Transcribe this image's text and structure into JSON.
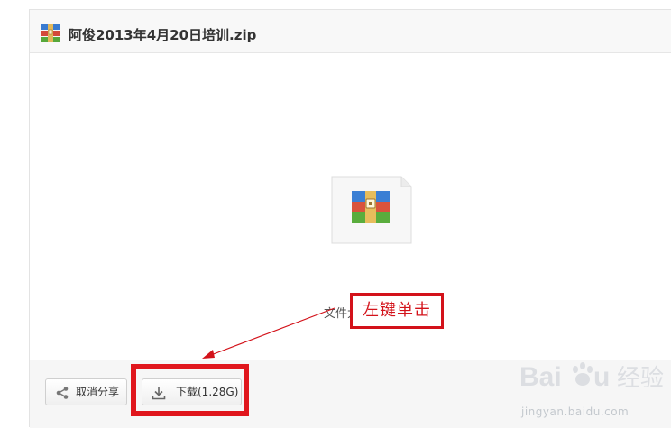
{
  "file": {
    "name": "阿俊2013年4月20日培训.zip",
    "size_label": "文件大小：1.28G",
    "icon": "winrar-archive-icon"
  },
  "toolbar": {
    "cancel_share_label": "取消分享",
    "download_label": "下载(1.28G)"
  },
  "annotation": {
    "callout_text": "左键单击",
    "highlight_color": "#e0161c"
  },
  "watermark": {
    "text": "jingyan.baidu.com"
  }
}
